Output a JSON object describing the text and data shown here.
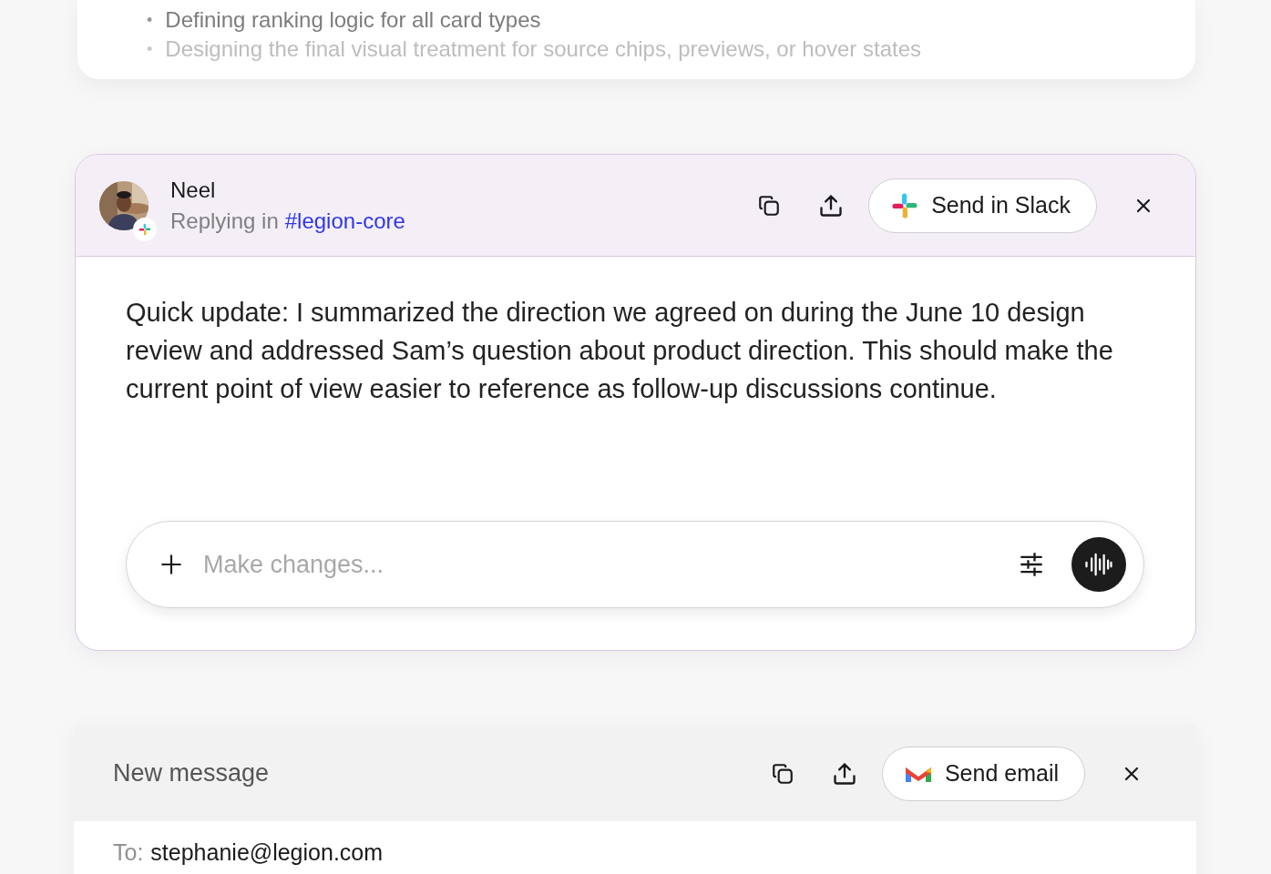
{
  "previous_card": {
    "bullets": [
      {
        "marker": "•",
        "text": "Defining ranking logic for all card types",
        "faded": false
      },
      {
        "marker": "•",
        "text": "Designing the final visual treatment for source chips, previews, or hover states",
        "faded": true
      }
    ]
  },
  "slack_draft": {
    "sender": "Neel",
    "context_prefix": "Replying in",
    "channel": "#legion-core",
    "send_button": "Send in Slack",
    "body": "Quick update: I summarized the direction we agreed on during the June 10 design review and addressed Sam’s question about product direction. This should make the current point of view easier to reference as follow-up discussions continue.",
    "composer": {
      "placeholder": "Make changes..."
    }
  },
  "email_draft": {
    "title": "New message",
    "send_button": "Send email",
    "to_label": "To:",
    "to_value": "stephanie@legion.com"
  }
}
